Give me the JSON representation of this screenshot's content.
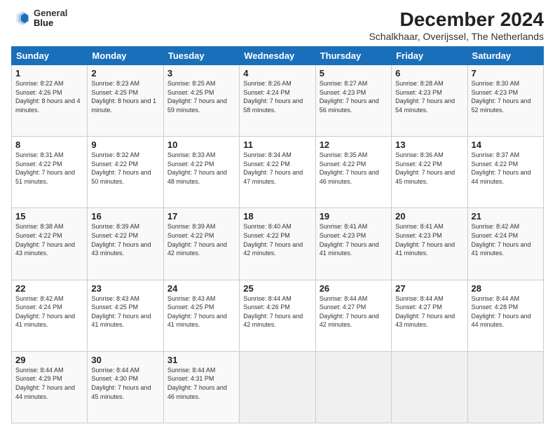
{
  "logo": {
    "line1": "General",
    "line2": "Blue"
  },
  "title": "December 2024",
  "subtitle": "Schalkhaar, Overijssel, The Netherlands",
  "headers": [
    "Sunday",
    "Monday",
    "Tuesday",
    "Wednesday",
    "Thursday",
    "Friday",
    "Saturday"
  ],
  "weeks": [
    [
      {
        "day": "1",
        "sunrise": "8:22 AM",
        "sunset": "4:26 PM",
        "daylight": "8 hours and 4 minutes."
      },
      {
        "day": "2",
        "sunrise": "8:23 AM",
        "sunset": "4:25 PM",
        "daylight": "8 hours and 1 minute."
      },
      {
        "day": "3",
        "sunrise": "8:25 AM",
        "sunset": "4:25 PM",
        "daylight": "7 hours and 59 minutes."
      },
      {
        "day": "4",
        "sunrise": "8:26 AM",
        "sunset": "4:24 PM",
        "daylight": "7 hours and 58 minutes."
      },
      {
        "day": "5",
        "sunrise": "8:27 AM",
        "sunset": "4:23 PM",
        "daylight": "7 hours and 56 minutes."
      },
      {
        "day": "6",
        "sunrise": "8:28 AM",
        "sunset": "4:23 PM",
        "daylight": "7 hours and 54 minutes."
      },
      {
        "day": "7",
        "sunrise": "8:30 AM",
        "sunset": "4:23 PM",
        "daylight": "7 hours and 52 minutes."
      }
    ],
    [
      {
        "day": "8",
        "sunrise": "8:31 AM",
        "sunset": "4:22 PM",
        "daylight": "7 hours and 51 minutes."
      },
      {
        "day": "9",
        "sunrise": "8:32 AM",
        "sunset": "4:22 PM",
        "daylight": "7 hours and 50 minutes."
      },
      {
        "day": "10",
        "sunrise": "8:33 AM",
        "sunset": "4:22 PM",
        "daylight": "7 hours and 48 minutes."
      },
      {
        "day": "11",
        "sunrise": "8:34 AM",
        "sunset": "4:22 PM",
        "daylight": "7 hours and 47 minutes."
      },
      {
        "day": "12",
        "sunrise": "8:35 AM",
        "sunset": "4:22 PM",
        "daylight": "7 hours and 46 minutes."
      },
      {
        "day": "13",
        "sunrise": "8:36 AM",
        "sunset": "4:22 PM",
        "daylight": "7 hours and 45 minutes."
      },
      {
        "day": "14",
        "sunrise": "8:37 AM",
        "sunset": "4:22 PM",
        "daylight": "7 hours and 44 minutes."
      }
    ],
    [
      {
        "day": "15",
        "sunrise": "8:38 AM",
        "sunset": "4:22 PM",
        "daylight": "7 hours and 43 minutes."
      },
      {
        "day": "16",
        "sunrise": "8:39 AM",
        "sunset": "4:22 PM",
        "daylight": "7 hours and 43 minutes."
      },
      {
        "day": "17",
        "sunrise": "8:39 AM",
        "sunset": "4:22 PM",
        "daylight": "7 hours and 42 minutes."
      },
      {
        "day": "18",
        "sunrise": "8:40 AM",
        "sunset": "4:22 PM",
        "daylight": "7 hours and 42 minutes."
      },
      {
        "day": "19",
        "sunrise": "8:41 AM",
        "sunset": "4:23 PM",
        "daylight": "7 hours and 41 minutes."
      },
      {
        "day": "20",
        "sunrise": "8:41 AM",
        "sunset": "4:23 PM",
        "daylight": "7 hours and 41 minutes."
      },
      {
        "day": "21",
        "sunrise": "8:42 AM",
        "sunset": "4:24 PM",
        "daylight": "7 hours and 41 minutes."
      }
    ],
    [
      {
        "day": "22",
        "sunrise": "8:42 AM",
        "sunset": "4:24 PM",
        "daylight": "7 hours and 41 minutes."
      },
      {
        "day": "23",
        "sunrise": "8:43 AM",
        "sunset": "4:25 PM",
        "daylight": "7 hours and 41 minutes."
      },
      {
        "day": "24",
        "sunrise": "8:43 AM",
        "sunset": "4:25 PM",
        "daylight": "7 hours and 41 minutes."
      },
      {
        "day": "25",
        "sunrise": "8:44 AM",
        "sunset": "4:26 PM",
        "daylight": "7 hours and 42 minutes."
      },
      {
        "day": "26",
        "sunrise": "8:44 AM",
        "sunset": "4:27 PM",
        "daylight": "7 hours and 42 minutes."
      },
      {
        "day": "27",
        "sunrise": "8:44 AM",
        "sunset": "4:27 PM",
        "daylight": "7 hours and 43 minutes."
      },
      {
        "day": "28",
        "sunrise": "8:44 AM",
        "sunset": "4:28 PM",
        "daylight": "7 hours and 44 minutes."
      }
    ],
    [
      {
        "day": "29",
        "sunrise": "8:44 AM",
        "sunset": "4:29 PM",
        "daylight": "7 hours and 44 minutes."
      },
      {
        "day": "30",
        "sunrise": "8:44 AM",
        "sunset": "4:30 PM",
        "daylight": "7 hours and 45 minutes."
      },
      {
        "day": "31",
        "sunrise": "8:44 AM",
        "sunset": "4:31 PM",
        "daylight": "7 hours and 46 minutes."
      },
      null,
      null,
      null,
      null
    ]
  ],
  "labels": {
    "sunrise": "Sunrise:",
    "sunset": "Sunset:",
    "daylight": "Daylight:"
  }
}
